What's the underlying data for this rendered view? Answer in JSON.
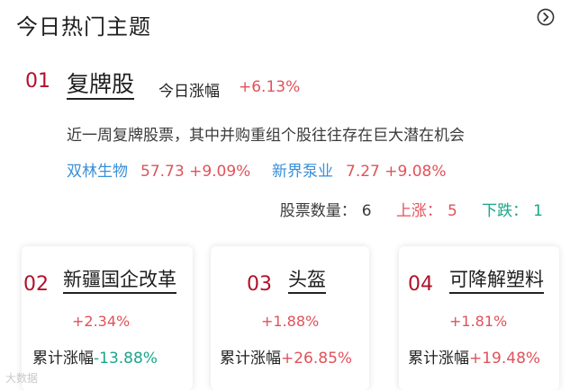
{
  "header": {
    "title": "今日热门主题",
    "more_icon": "chevron-right-circle-icon"
  },
  "top_topic": {
    "rank": "01",
    "name": "复牌股",
    "day_label": "今日涨幅",
    "day_change": "+6.13%",
    "description": "近一周复牌股票，其中并购重组个股往往存在巨大潜在机会",
    "stocks": [
      {
        "name": "双林生物",
        "quote": "57.73 +9.09%"
      },
      {
        "name": "新界泵业",
        "quote": "7.27 +9.08%"
      }
    ],
    "counts": {
      "total_label": "股票数量：",
      "total": "6",
      "up_label": "上涨：",
      "up": "5",
      "down_label": "下跌：",
      "down": "1"
    }
  },
  "cards": [
    {
      "rank": "02",
      "name": "新疆国企改革",
      "change": "+2.34%",
      "cum_label": "累计涨幅",
      "cum_value": "-13.88%"
    },
    {
      "rank": "03",
      "name": "头盔",
      "change": "+1.88%",
      "cum_label": "累计涨幅",
      "cum_value": "+26.85%"
    },
    {
      "rank": "04",
      "name": "可降解塑料",
      "change": "+1.81%",
      "cum_label": "累计涨幅",
      "cum_value": "+19.48%"
    }
  ],
  "watermark": "大数据"
}
